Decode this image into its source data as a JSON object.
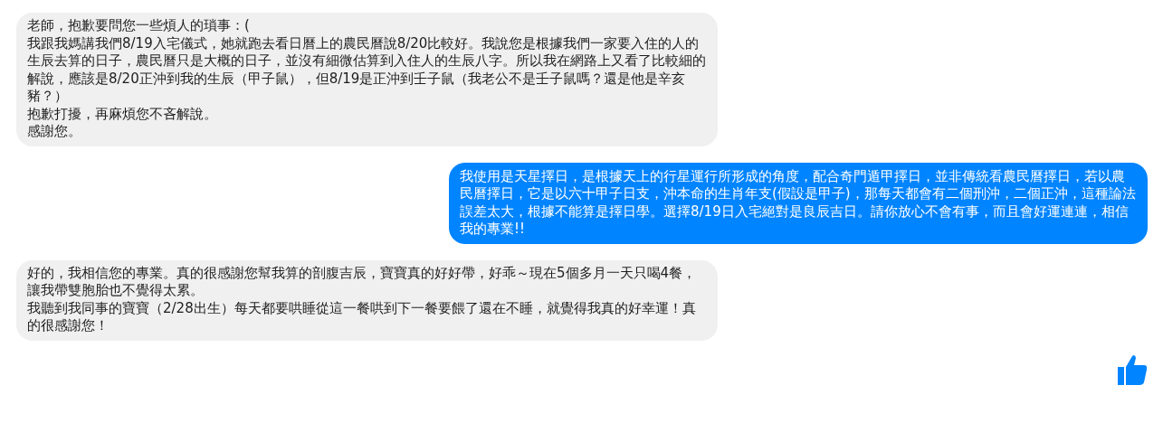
{
  "messages": [
    {
      "kind": "received",
      "paragraphs": [
        "老師，抱歉要問您一些煩人的瑣事：(",
        "我跟我媽講我們8/19入宅儀式，她就跑去看日曆上的農民曆說8/20比較好。我說您是根據我們一家要入住的人的生辰去算的日子，農民曆只是大概的日子，並沒有細微估算到入住人的生辰八字。所以我在網路上又看了比較細的解說，應該是8/20正沖到我的生辰（甲子鼠），但8/19是正沖到壬子鼠（我老公不是壬子鼠嗎？還是他是辛亥豬？）",
        "抱歉打擾，再麻煩您不吝解說。",
        "感謝您。"
      ]
    },
    {
      "kind": "sent",
      "paragraphs": [
        "我使用是天星擇日，是根據天上的行星運行所形成的角度，配合奇門遁甲擇日，並非傳統看農民曆擇日，若以農民曆擇日，它是以六十甲子日支，沖本命的生肖年支(假設是甲子)，那每天都會有二個刑沖，二個正沖，這種論法誤差太大，根據不能算是擇日學。選擇8/19日入宅絕對是良辰吉日。請你放心不會有事，而且會好運連連，相信我的專業!!"
      ]
    },
    {
      "kind": "received",
      "paragraphs": [
        "好的，我相信您的專業。真的很感謝您幫我算的剖腹吉辰，寶寶真的好好帶，好乖～現在5個多月一天只喝4餐，讓我帶雙胞胎也不覺得太累。",
        "我聽到我同事的寶寶（2/28出生）每天都要哄睡從這一餐哄到下一餐要餵了還在不睡，就覺得我真的好幸運！真的很感謝您！"
      ]
    }
  ]
}
